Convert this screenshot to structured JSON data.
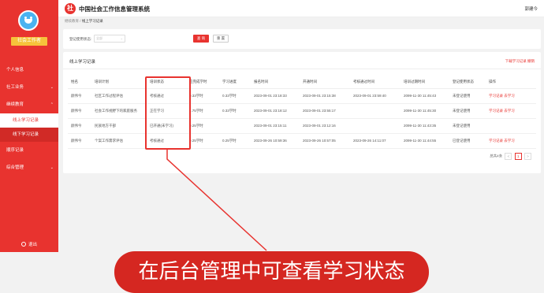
{
  "sidebar": {
    "brand_label": "社会工作者",
    "menu": [
      {
        "label": "个人信息"
      },
      {
        "label": "社工业务"
      },
      {
        "label": "继续教育"
      },
      {
        "label": "线上学习记录"
      },
      {
        "label": "线下学习记录"
      },
      {
        "label": "顺序记录"
      },
      {
        "label": "综合管理"
      }
    ],
    "logout_label": "退出"
  },
  "header": {
    "system_title": "中国社会工作信息管理系统",
    "user_name": "郭建今"
  },
  "breadcrumb": {
    "home": "继续教育",
    "separator": "/",
    "current": "线上学习记录"
  },
  "filter": {
    "label": "登记使用状态:",
    "select_placeholder": "全部",
    "query_label": "查 询",
    "reset_label": "重 置"
  },
  "panel": {
    "title": "线上学习记录",
    "actions": "下载学习记录  撤销"
  },
  "table": {
    "columns": [
      "姓名",
      "培训计划",
      "培训状态",
      "应完成学时",
      "学习进度",
      "报名时间",
      "开通时间",
      "考核通过时间",
      "培训过期时间",
      "登记使用状态",
      "操作"
    ],
    "rows": [
      [
        "颜伟今",
        "社区工作过程评估",
        "考核通过",
        "0.33学时",
        "0.33学时",
        "2023-09-01 23:18:33",
        "2023-09-01 23:15:38",
        "2023-09-01 23:59:40",
        "2099-11-30 11:45:43",
        "未登记使用",
        "学习记录  去学习"
      ],
      [
        "颜伟今",
        "社会工作视野下的家庭服务",
        "正在学习",
        "1.75学时",
        "0.33学时",
        "2023-09-01 23:18:12",
        "2023-09-01 23:55:17",
        "",
        "2099-11-30 11:45:30",
        "未登记使用",
        "学习记录  去学习"
      ],
      [
        "颜伟今",
        "民族地方干部",
        "已开通(未学习)",
        "0.25学时",
        "",
        "2023-09-01 23:15:11",
        "2023-09-01 23:12:16",
        "",
        "2099-11-30 11:43:35",
        "未登记使用",
        ""
      ],
      [
        "颜伟今",
        "个案工作需求评估",
        "考核通过",
        "0.25学时",
        "0.25学时",
        "2023-09-26 10:59:36",
        "2023-09-26 10:57:05",
        "2023-09-26 14:11:07",
        "2099-11-30 11:44:55",
        "已登记使用",
        "学习记录  去学习"
      ]
    ]
  },
  "pagination": {
    "total": "总共4条",
    "prev": "<",
    "current_page": "1",
    "next": ">"
  },
  "caption": "在后台管理中可查看学习状态",
  "colors": {
    "primary": "#e8332f",
    "accent_yellow": "#f6c23b",
    "caption_bg": "#d52721"
  }
}
